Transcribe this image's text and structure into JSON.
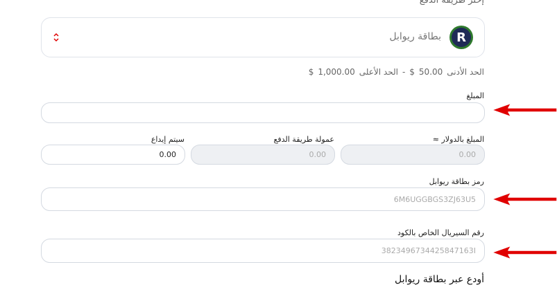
{
  "section_title": "إختر طريقة الدفع",
  "payment_method": {
    "label": "بطاقة ريوابل",
    "logo_letter": "R",
    "icon": "sort-arrows-icon"
  },
  "limits": {
    "min_label": "الحد الأدنى",
    "min_value": "50.00",
    "separator": "-",
    "max_label": "الحد الأعلى",
    "max_value": "1,000.00",
    "currency": "$"
  },
  "fields": {
    "amount": {
      "label": "المبلغ",
      "value": ""
    },
    "amount_usd": {
      "label": "المبلغ بالدولار ≈",
      "placeholder": "0.00"
    },
    "commission": {
      "label": "عمولة طريقة الدفع",
      "placeholder": "0.00"
    },
    "deposited": {
      "label": "سيتم إيداع",
      "value": "0.00"
    },
    "card_code": {
      "label": "رمز بطاقة ريوابل",
      "placeholder": "6M6UGGBGS3ZJ63U5"
    },
    "serial": {
      "label": "رقم السيريال الخاص بالكود",
      "placeholder": "3823496734425847163Ι"
    }
  },
  "deposit_title": "أودع عبر بطاقة ريوابل",
  "colors": {
    "arrow": "#e00000",
    "border": "#d4d9e1",
    "disabled_bg": "#eef0f3"
  }
}
